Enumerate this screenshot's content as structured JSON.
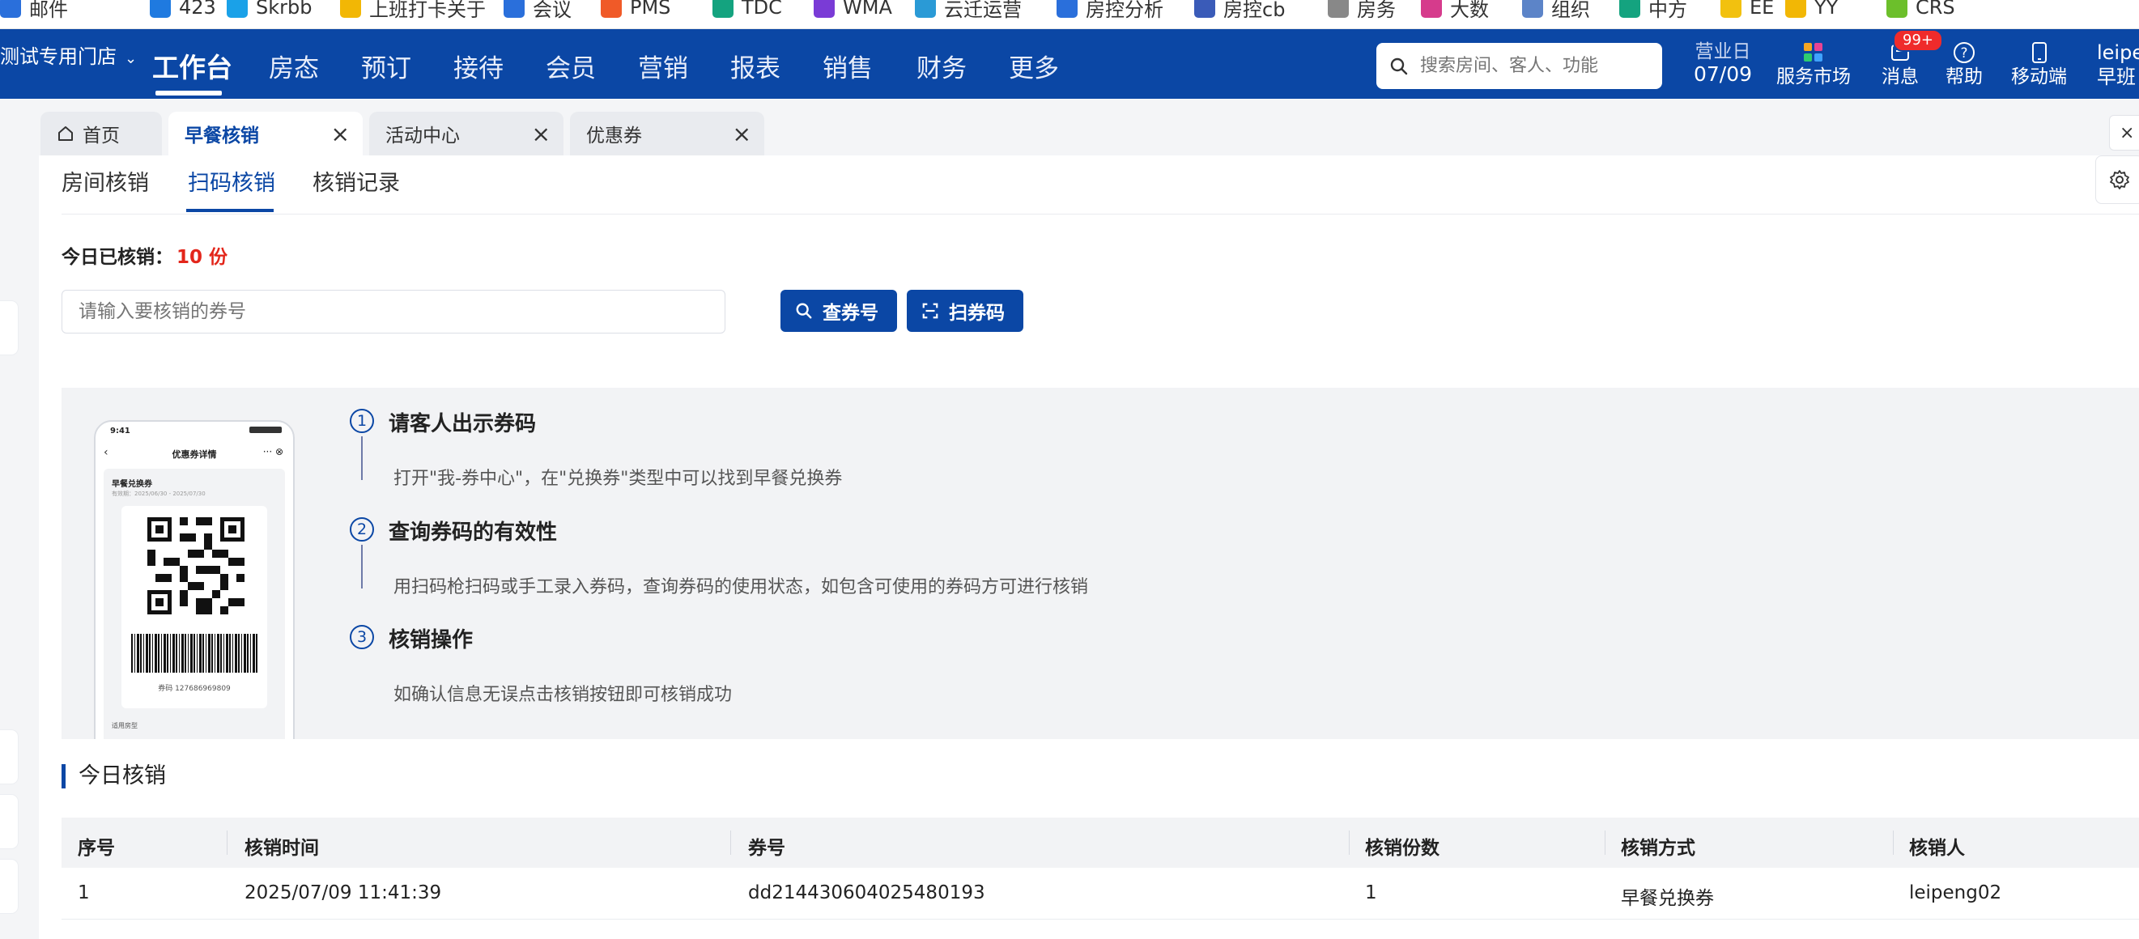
{
  "bookmarks": [
    {
      "label": "邮件",
      "color": "#2a6fdb"
    },
    {
      "label": "423",
      "color": "#1f7ae0"
    },
    {
      "label": "Skrbb",
      "color": "#1aa1e8"
    },
    {
      "label": "上班打卡关于",
      "color": "#f2b705"
    },
    {
      "label": "会议",
      "color": "#2a6fdb"
    },
    {
      "label": "PMS",
      "color": "#f05a28"
    },
    {
      "label": "TDC",
      "color": "#14a37f"
    },
    {
      "label": "WMA",
      "color": "#7a3bd6"
    },
    {
      "label": "云迁运营",
      "color": "#2a9ad6"
    },
    {
      "label": "房控分析",
      "color": "#2a6fdb"
    },
    {
      "label": "房控cb",
      "color": "#3a5bb8"
    },
    {
      "label": "房务",
      "color": "#888888"
    },
    {
      "label": "大数",
      "color": "#d63b8c"
    },
    {
      "label": "组织",
      "color": "#5c84c8"
    },
    {
      "label": "中方",
      "color": "#14a37f"
    },
    {
      "label": "EE",
      "color": "#f2c10f"
    },
    {
      "label": "YY",
      "color": "#f2b705"
    },
    {
      "label": "CRS",
      "color": "#6cbf2b"
    }
  ],
  "store": {
    "name": "测试专用门店"
  },
  "nav": {
    "items": [
      "工作台",
      "房态",
      "预订",
      "接待",
      "会员",
      "营销",
      "报表",
      "销售",
      "财务",
      "更多"
    ],
    "active_index": 0
  },
  "search": {
    "placeholder": "搜索房间、客人、功能"
  },
  "business_day": {
    "label": "营业日",
    "date": "07/09"
  },
  "header_actions": {
    "market": "服务市场",
    "messages": "消息",
    "messages_badge": "99+",
    "help": "帮助",
    "mobile": "移动端"
  },
  "user": {
    "name": "leipe",
    "shift": "早班"
  },
  "tabs": [
    {
      "label": "首页",
      "closable": false
    },
    {
      "label": "早餐核销",
      "closable": true,
      "active": true
    },
    {
      "label": "活动中心",
      "closable": true
    },
    {
      "label": "优惠券",
      "closable": true
    }
  ],
  "close_all_label": "×",
  "subtabs": [
    "房间核销",
    "扫码核销",
    "核销记录"
  ],
  "subtab_active_index": 1,
  "today_count": {
    "label": "今日已核销：",
    "value": "10 份"
  },
  "voucher_input": {
    "placeholder": "请输入要核销的券号"
  },
  "buttons": {
    "query": "查券号",
    "scan": "扫券码"
  },
  "phone_mock": {
    "time": "9:41",
    "title": "优惠券详情",
    "voucher_name": "早餐兑换券",
    "validity": "有效期：2025/06/30 - 2025/07/30",
    "code_label": "券码 127686969809",
    "footer": "适用房型"
  },
  "steps": [
    {
      "num": "1",
      "title": "请客人出示券码",
      "desc": "打开\"我-券中心\"，在\"兑换券\"类型中可以找到早餐兑换券"
    },
    {
      "num": "2",
      "title": "查询券码的有效性",
      "desc": "用扫码枪扫码或手工录入券码，查询券码的使用状态，如包含可使用的券码方可进行核销"
    },
    {
      "num": "3",
      "title": "核销操作",
      "desc": "如确认信息无误点击核销按钮即可核销成功"
    }
  ],
  "section_title": "今日核销",
  "table": {
    "columns": [
      "序号",
      "核销时间",
      "券号",
      "核销份数",
      "核销方式",
      "核销人"
    ],
    "rows": [
      [
        "1",
        "2025/07/09 11:41:39",
        "dd214430604025480193",
        "1",
        "早餐兑换券",
        "leipeng02"
      ]
    ]
  },
  "colors": {
    "brand": "#0b47a5",
    "count_red": "#e3261b",
    "badge_red": "#ef2b2b"
  }
}
